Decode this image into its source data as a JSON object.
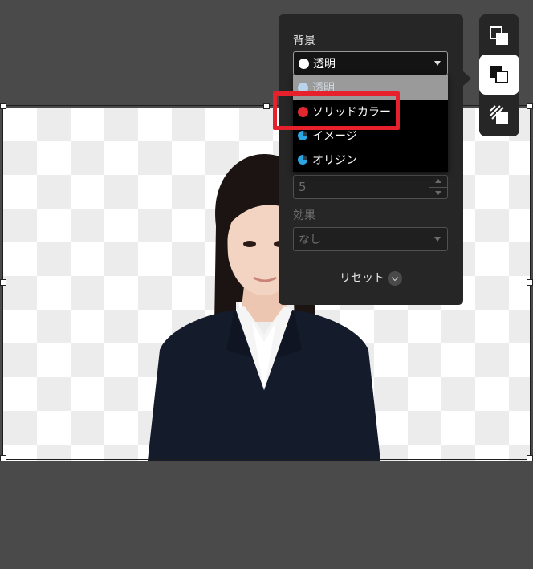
{
  "panel": {
    "title": "背景",
    "selected_value": "透明",
    "selected_dot_color": "#ffffff",
    "options": [
      {
        "label": "透明",
        "icon": "white-dot",
        "color": "#b9d3ec"
      },
      {
        "label": "ソリッドカラー",
        "icon": "red-dot",
        "color": "#e0282e"
      },
      {
        "label": "イメージ",
        "icon": "pie-icon"
      },
      {
        "label": "オリジン",
        "icon": "pie-icon"
      }
    ],
    "number_value": "5",
    "effect_label": "効果",
    "effect_value": "なし",
    "reset_label": "リセット"
  },
  "toolbar": {
    "buttons": [
      {
        "icon": "layer-front-icon",
        "active": false
      },
      {
        "icon": "layer-background-icon",
        "active": true
      },
      {
        "icon": "layer-pattern-icon",
        "active": false
      }
    ]
  },
  "colors": {
    "app_background": "#4a4a4a",
    "panel_background": "#262626",
    "annotation": "#e6212b"
  }
}
